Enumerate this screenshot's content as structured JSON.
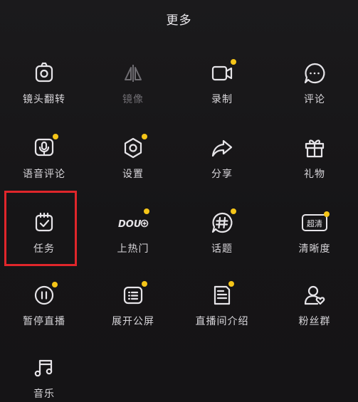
{
  "header": {
    "title": "更多"
  },
  "grid": {
    "items": [
      {
        "label": "镜头翻转",
        "icon": "camera-flip-icon",
        "dot": false,
        "dim": false
      },
      {
        "label": "镜像",
        "icon": "mirror-icon",
        "dot": false,
        "dim": true
      },
      {
        "label": "录制",
        "icon": "record-video-icon",
        "dot": true,
        "dim": false
      },
      {
        "label": "评论",
        "icon": "comment-bubble-icon",
        "dot": false,
        "dim": false
      },
      {
        "label": "语音评论",
        "icon": "voice-comment-icon",
        "dot": true,
        "dim": false
      },
      {
        "label": "设置",
        "icon": "settings-gear-icon",
        "dot": true,
        "dim": false
      },
      {
        "label": "分享",
        "icon": "share-arrow-icon",
        "dot": false,
        "dim": false
      },
      {
        "label": "礼物",
        "icon": "gift-icon",
        "dot": false,
        "dim": false
      },
      {
        "label": "任务",
        "icon": "task-calendar-icon",
        "dot": false,
        "dim": false
      },
      {
        "label": "上热门",
        "icon": "dou-plus-icon",
        "dot": true,
        "dim": false
      },
      {
        "label": "话题",
        "icon": "topic-hashtag-icon",
        "dot": true,
        "dim": false
      },
      {
        "label": "清晰度",
        "icon": "hd-quality-icon",
        "dot": true,
        "dim": false
      },
      {
        "label": "暂停直播",
        "icon": "pause-live-icon",
        "dot": true,
        "dim": false
      },
      {
        "label": "展开公屏",
        "icon": "expand-screen-icon",
        "dot": true,
        "dim": false
      },
      {
        "label": "直播间介绍",
        "icon": "room-intro-icon",
        "dot": true,
        "dim": false
      },
      {
        "label": "粉丝群",
        "icon": "fan-group-icon",
        "dot": false,
        "dim": false
      },
      {
        "label": "音乐",
        "icon": "music-note-icon",
        "dot": false,
        "dim": false
      }
    ],
    "icon_texts": {
      "dou": "DOU",
      "hd": "超清"
    }
  },
  "colors": {
    "accent_dot": "#f5c518",
    "highlight_border": "#e0262b",
    "background": "#171617",
    "icon_stroke": "#e6e4e8"
  }
}
